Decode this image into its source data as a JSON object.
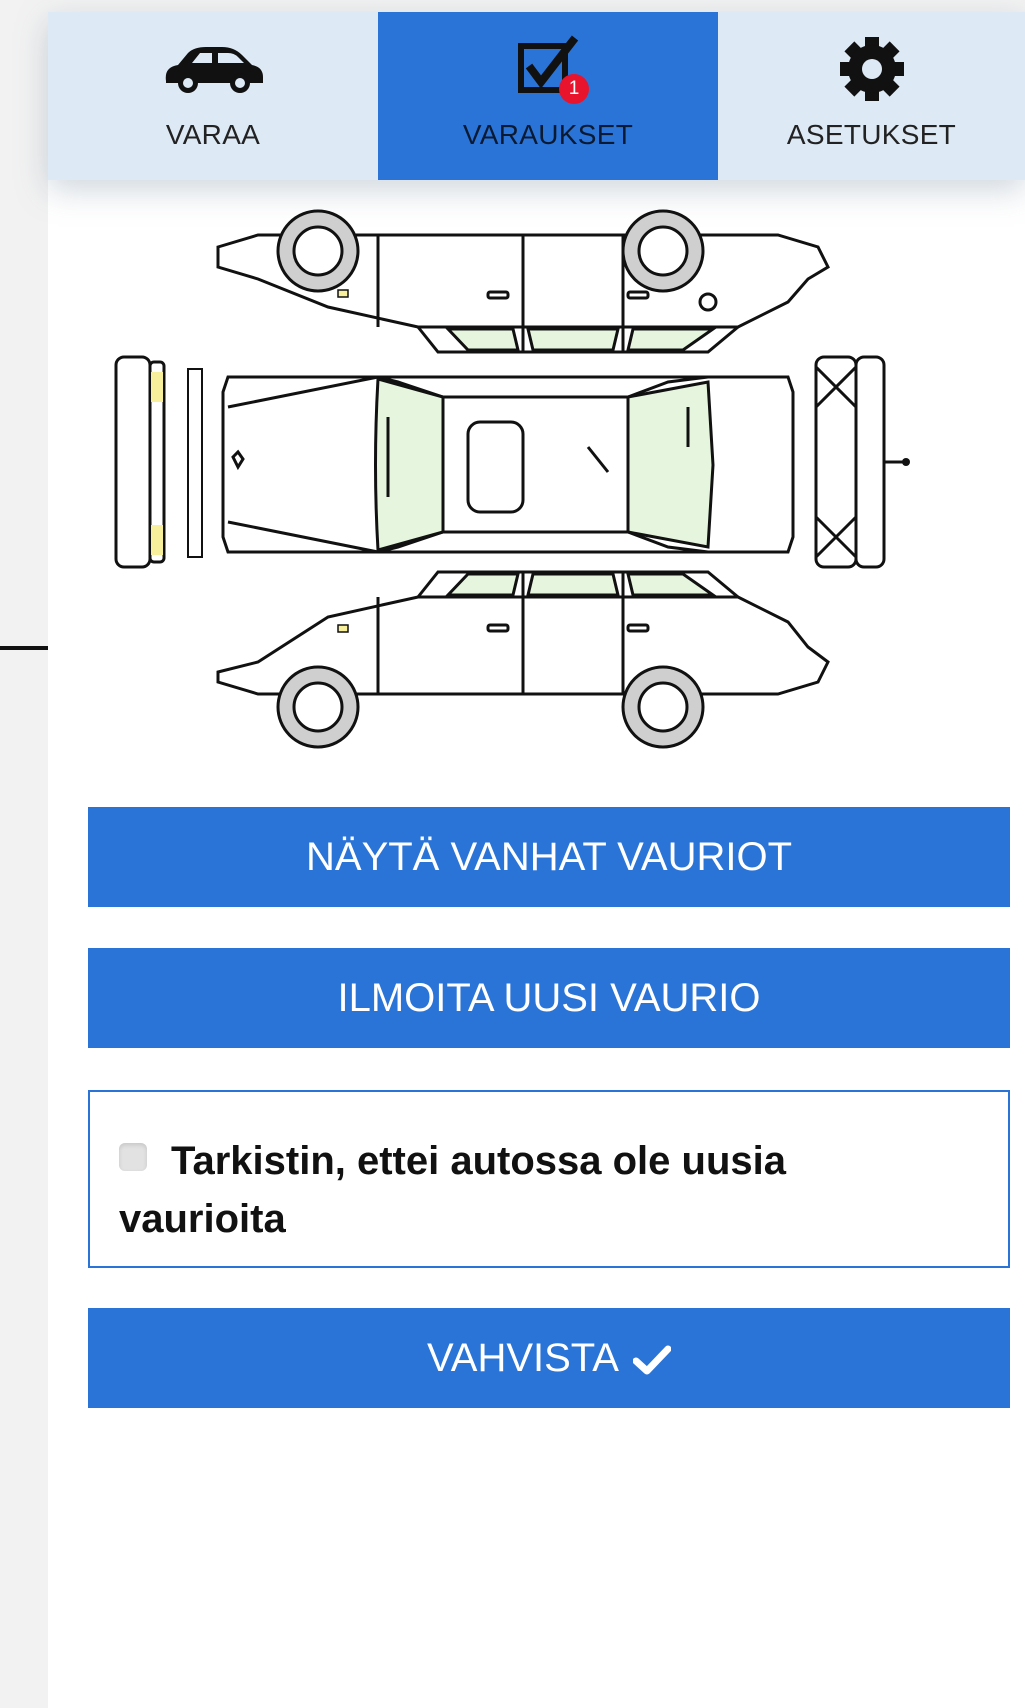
{
  "tabs": [
    {
      "label": "VARAA",
      "icon": "car-icon",
      "active": false
    },
    {
      "label": "VARAUKSET",
      "icon": "checklist-icon",
      "active": true,
      "badge": "1"
    },
    {
      "label": "ASETUKSET",
      "icon": "gear-icon",
      "active": false
    }
  ],
  "diagram": {
    "icon": "car-damage-diagram"
  },
  "buttons": {
    "show_old": "NÄYTÄ VANHAT VAURIOT",
    "report_new": "ILMOITA UUSI VAURIO",
    "confirm": "VAHVISTA"
  },
  "confirmation": {
    "text": "Tarkistin, ettei autossa ole uusia vaurioita",
    "checked": false
  },
  "colors": {
    "accent": "#2a74d8",
    "tabbar": "#dde9f5",
    "badge": "#e8142d",
    "glass": "#e6f5de",
    "marker": "#f7ef9c"
  }
}
